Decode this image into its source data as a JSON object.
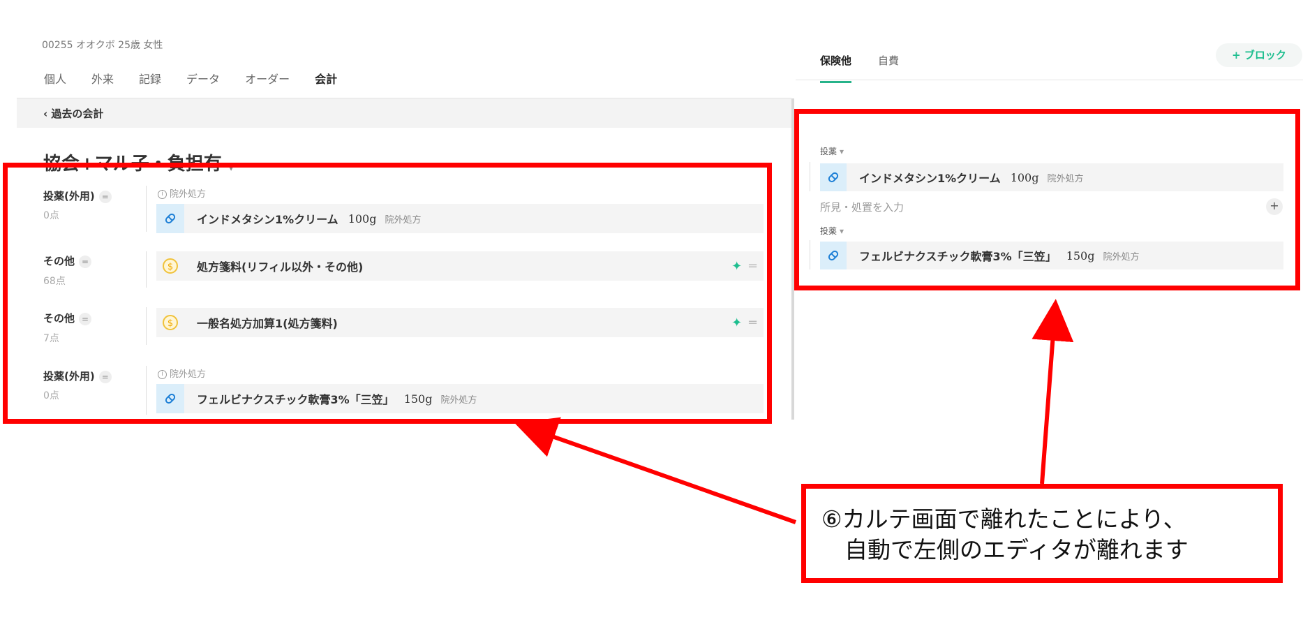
{
  "patient_header": "00255 オオクボ 25歳 女性",
  "tabs": [
    "個人",
    "外来",
    "記録",
    "データ",
    "オーダー",
    "会計"
  ],
  "active_tab": "会計",
  "back_link": "過去の会計",
  "group_title": "協会+マル子・負担有",
  "rows": [
    {
      "label": "投薬(外用)",
      "points": "0点",
      "note": "院外処方",
      "name": "インドメタシン1%クリーム",
      "qty": "100g",
      "item_note": "院外処方"
    },
    {
      "label": "その他",
      "points": "68点",
      "name": "処方箋料(リフィル以外・その他)"
    },
    {
      "label": "その他",
      "points": "7点",
      "name": "一般名処方加算1(処方箋料)"
    },
    {
      "label": "投薬(外用)",
      "points": "0点",
      "note": "院外処方",
      "name": "フェルビナクスチック軟膏3%「三笠」",
      "qty": "150g",
      "item_note": "院外処方"
    }
  ],
  "right": {
    "tabs": [
      "保険他",
      "自費"
    ],
    "active_tab": "保険他",
    "block_button": "+ ブロック",
    "section1": "投薬",
    "item1": {
      "name": "インドメタシン1%クリーム",
      "qty": "100g",
      "note": "院外処方"
    },
    "finding_placeholder": "所見・処置を入力",
    "section2": "投薬",
    "item2": {
      "name": "フェルビナクスチック軟膏3%「三笠」",
      "qty": "150g",
      "note": "院外処方"
    }
  },
  "annotation": {
    "line1": "⑥カルテ画面で離れたことにより、",
    "line2": "　自動で左側のエディタが離れます"
  },
  "colors": {
    "accent": "#27b38a",
    "highlight": "#ff0000",
    "pill_bg": "#dbeefa",
    "coin": "#f0c23a"
  }
}
